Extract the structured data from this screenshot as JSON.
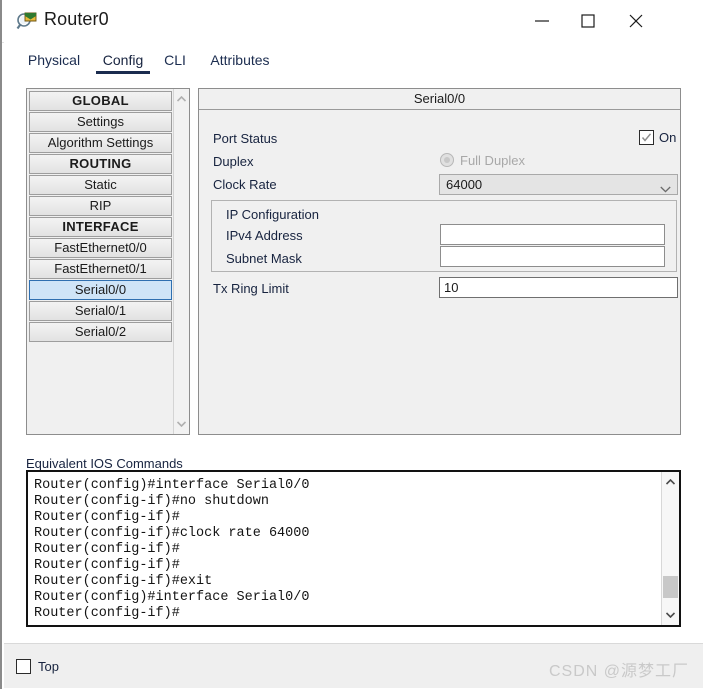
{
  "window": {
    "title": "Router0",
    "icon": "router-magnifier-icon",
    "controls": {
      "minimize": "minimize-icon",
      "maximize": "maximize-icon",
      "close": "close-icon"
    }
  },
  "tabs": [
    {
      "label": "Physical",
      "active": false
    },
    {
      "label": "Config",
      "active": true
    },
    {
      "label": "CLI",
      "active": false
    },
    {
      "label": "Attributes",
      "active": false
    }
  ],
  "sidebar": {
    "items": [
      {
        "label": "GLOBAL",
        "type": "header"
      },
      {
        "label": "Settings",
        "type": "item"
      },
      {
        "label": "Algorithm Settings",
        "type": "item"
      },
      {
        "label": "ROUTING",
        "type": "header"
      },
      {
        "label": "Static",
        "type": "item"
      },
      {
        "label": "RIP",
        "type": "item"
      },
      {
        "label": "INTERFACE",
        "type": "header"
      },
      {
        "label": "FastEthernet0/0",
        "type": "item"
      },
      {
        "label": "FastEthernet0/1",
        "type": "item"
      },
      {
        "label": "Serial0/0",
        "type": "item",
        "selected": true
      },
      {
        "label": "Serial0/1",
        "type": "item"
      },
      {
        "label": "Serial0/2",
        "type": "item"
      }
    ]
  },
  "main": {
    "panel_title": "Serial0/0",
    "port_status": {
      "label": "Port Status",
      "checkbox_label": "On",
      "checked": true
    },
    "duplex": {
      "label": "Duplex",
      "option_label": "Full Duplex",
      "selected": true,
      "disabled": true
    },
    "clock_rate": {
      "label": "Clock Rate",
      "value": "64000"
    },
    "ip_configuration": {
      "group_label": "IP Configuration",
      "ipv4_label": "IPv4 Address",
      "ipv4_value": "",
      "ipv4_placeholder": "",
      "subnet_label": "Subnet Mask",
      "subnet_value": "",
      "subnet_placeholder": ""
    },
    "tx_ring_limit": {
      "label": "Tx Ring Limit",
      "value": "10"
    }
  },
  "console": {
    "label": "Equivalent IOS Commands",
    "clipped_first_line": "Router(config-if)#exit",
    "lines": [
      "Router(config)#interface Serial0/0",
      "Router(config-if)#no shutdown",
      "Router(config-if)#",
      "Router(config-if)#clock rate 64000",
      "Router(config-if)#",
      "Router(config-if)#",
      "Router(config-if)#exit",
      "Router(config)#interface Serial0/0",
      "Router(config-if)#"
    ],
    "text": "Router(config)#interface Serial0/0\nRouter(config-if)#no shutdown\nRouter(config-if)#\nRouter(config-if)#clock rate 64000\nRouter(config-if)#\nRouter(config-if)#\nRouter(config-if)#exit\nRouter(config)#interface Serial0/0\nRouter(config-if)#"
  },
  "footer": {
    "top_label": "Top",
    "top_checked": false,
    "watermark": "CSDN @源梦工厂"
  },
  "colors": {
    "accent": "#1b2c4f",
    "selection": "#cfe4f7",
    "selection_border": "#2f6fb0",
    "panel": "#f0f0f0",
    "text": "#17233f",
    "disabled_text": "#a8a8a8"
  }
}
